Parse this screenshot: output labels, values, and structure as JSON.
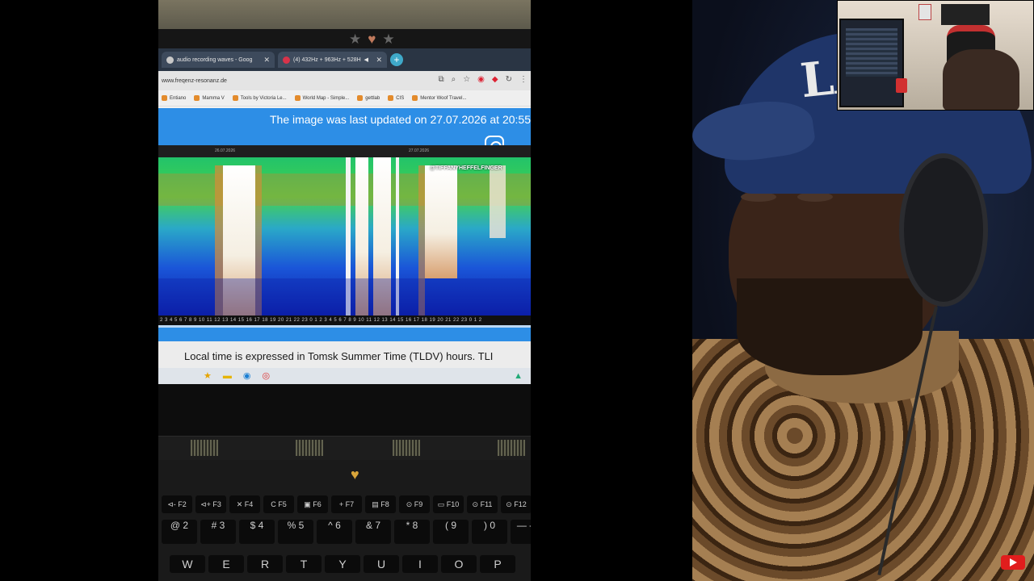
{
  "browser": {
    "tabs": [
      {
        "label": "audio recording waves - Goog"
      },
      {
        "label": "(4) 432Hz + 963Hz + 528H"
      }
    ],
    "url": "www.freqenz-resonanz.de",
    "bookmarks": [
      "Entiano",
      "Mamma V",
      "Tools by Victoria Le...",
      "World Map - Simple...",
      "gettlab",
      "CIS",
      "Mentor Woof Travel..."
    ]
  },
  "page": {
    "banner": "The image was last updated on 27.07.2026 at 20:55",
    "dates": [
      "26.07.2026",
      "27.07.2026"
    ],
    "watermark": "@TIFFANYHEFFELFINGER",
    "hours": "2 3 4 5 6 7 8 9 10 11 12 13 14 15 16 17 18 19 20 21 22 23 0 1 2 3 4 5 6 7 8 9 10 11 12 13 14 15 16 17 18 19 20 21 22 23 0 1 2",
    "footnote": "Local time is expressed in Tomsk Summer Time (TLDV) hours. TLI"
  },
  "laptop": {
    "fkeys": [
      "⊲- F2",
      "⊲+ F3",
      "✕ F4",
      "C F5",
      "▣ F6",
      "+ F7",
      "▤ F8",
      "⊙ F9",
      "▭ F10",
      "⊙ F11",
      "⊙ F12"
    ],
    "numkeys": [
      "@ 2",
      "# 3",
      "$ 4",
      "% 5",
      "^ 6",
      "& 7",
      "* 8",
      "( 9",
      ") 0",
      "— -"
    ],
    "letterkeys": [
      "W",
      "E",
      "R",
      "T",
      "Y",
      "U",
      "I",
      "O",
      "P"
    ]
  },
  "webcam": {
    "cap_logo": "LA"
  },
  "colors": {
    "banner_blue": "#2d8ee6",
    "youtube_red": "#e11d1d"
  }
}
